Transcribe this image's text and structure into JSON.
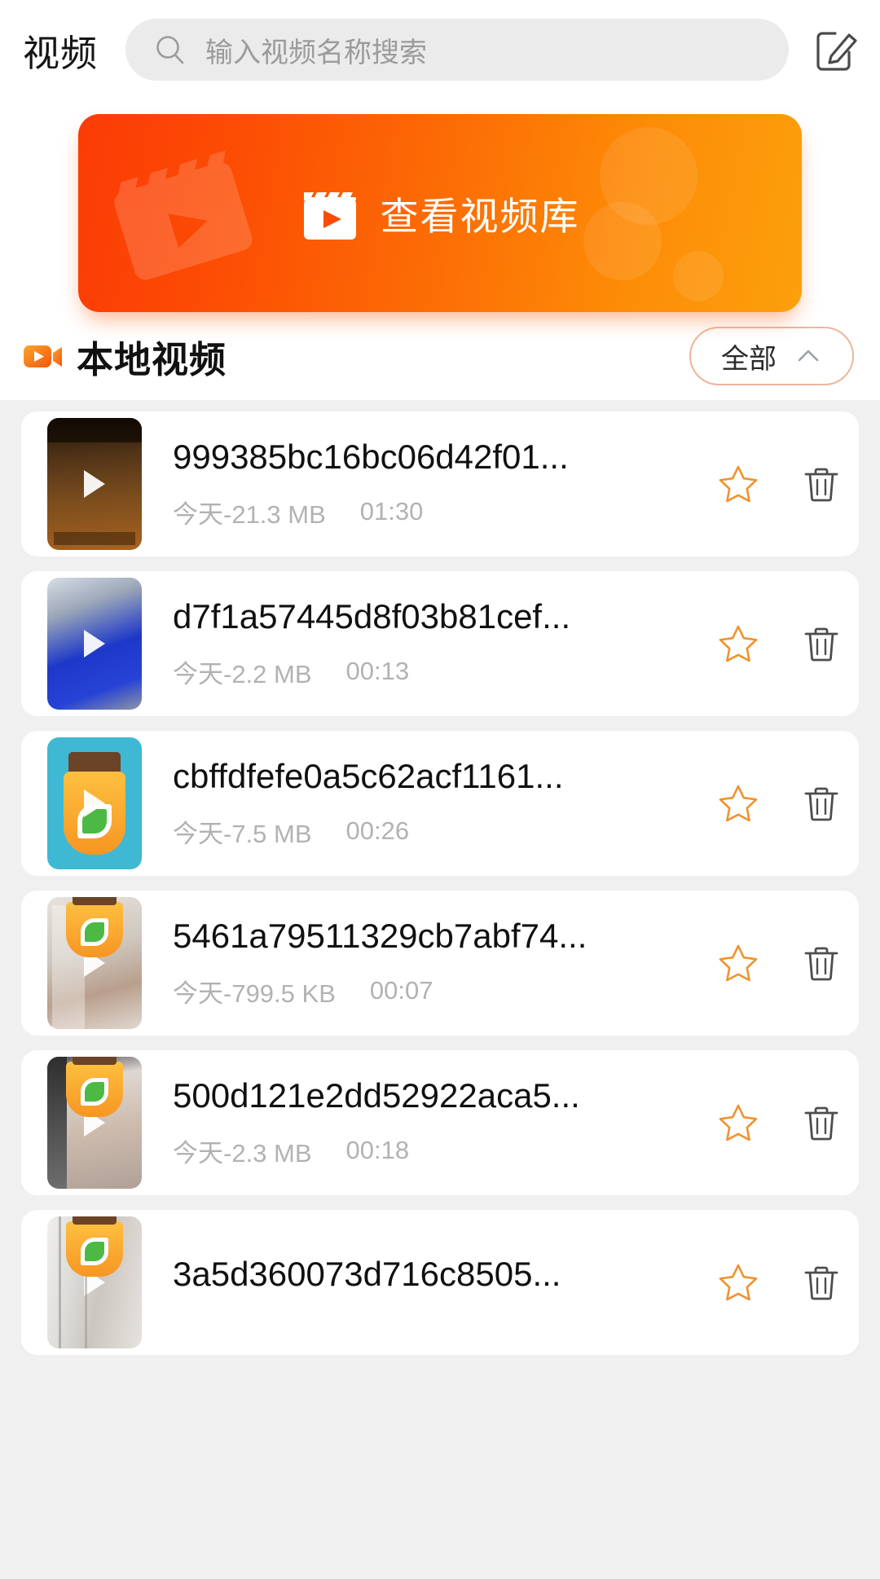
{
  "header": {
    "title": "视频",
    "search_placeholder": "输入视频名称搜索",
    "search_value": "",
    "search_icon": "search-icon",
    "compose_icon": "compose-edit-icon"
  },
  "banner": {
    "label": "查看视频库",
    "icon": "clapperboard-play-icon",
    "gradient_start": "#fb3b06",
    "gradient_end": "#fca00c"
  },
  "section": {
    "title": "本地视频",
    "icon": "video-camera-icon",
    "filter": {
      "label": "全部",
      "chevron": "chevron-up-icon",
      "border_color": "#f0b49c"
    }
  },
  "actions": {
    "star_icon": "star-outline-icon",
    "star_color": "#f0922f",
    "trash_icon": "trash-can-icon",
    "trash_color": "#4d4d4d"
  },
  "videos": [
    {
      "name": "999385bc16bc06d42f01...",
      "date": "今天",
      "size": "21.3 MB",
      "meta": "今天-21.3 MB",
      "duration": "01:30",
      "thumb": "tb-hk",
      "sticker": false
    },
    {
      "name": "d7f1a57445d8f03b81cef...",
      "date": "今天",
      "size": "2.2 MB",
      "meta": "今天-2.2 MB",
      "duration": "00:13",
      "thumb": "tb-blue",
      "sticker": false
    },
    {
      "name": "cbffdfefe0a5c62acf1161...",
      "date": "今天",
      "size": "7.5 MB",
      "meta": "今天-7.5 MB",
      "duration": "00:26",
      "thumb": "tb-jar",
      "sticker": false
    },
    {
      "name": "5461a79511329cb7abf74...",
      "date": "今天",
      "size": "799.5 KB",
      "meta": "今天-799.5 KB",
      "duration": "00:07",
      "thumb": "tb-room",
      "sticker": true
    },
    {
      "name": "500d121e2dd52922aca5...",
      "date": "今天",
      "size": "2.3 MB",
      "meta": "今天-2.3 MB",
      "duration": "00:18",
      "thumb": "tb-hall",
      "sticker": true
    },
    {
      "name": "3a5d360073d716c8505...",
      "date": "今天",
      "size": "",
      "meta": "",
      "duration": "",
      "thumb": "tb-curtain",
      "sticker": true
    }
  ]
}
